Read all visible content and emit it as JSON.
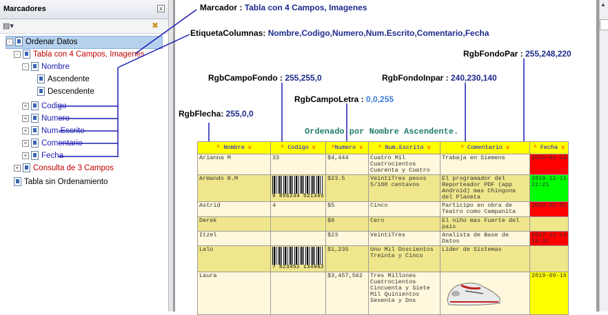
{
  "panel": {
    "title": "Marcadores",
    "close": "x",
    "options_icon": "options-menu-icon",
    "delete_icon": "delete-bookmark-icon"
  },
  "tree": {
    "root": {
      "toggle": "-",
      "label": "Ordenar Datos"
    },
    "item1": {
      "toggle": "-",
      "label": "Tabla con 4 Campos, Imagenes"
    },
    "nombre": {
      "toggle": "-",
      "label": "Nombre"
    },
    "asc": {
      "label": "Ascendente"
    },
    "desc": {
      "label": "Descendente"
    },
    "codigo": {
      "toggle": "+",
      "label": "Codigo"
    },
    "numero": {
      "toggle": "+",
      "label": "Numero"
    },
    "numescrito": {
      "toggle": "+",
      "label": "Num.Escrito"
    },
    "comentario": {
      "toggle": "+",
      "label": "Comentario"
    },
    "fecha": {
      "toggle": "+",
      "label": "Fecha"
    },
    "consulta": {
      "toggle": "+",
      "label": "Consulta de 3 Campos"
    },
    "sin": {
      "label": "Tabla sin Ordenamiento"
    }
  },
  "annotations": {
    "marcador": {
      "key": "Marcador : ",
      "value": "Tabla con 4 Campos, Imagenes"
    },
    "etiqueta": {
      "key": "EtiquetaColumnas: ",
      "value": "Nombre,Codigo,Numero,Num.Escrito,Comentario,Fecha"
    },
    "fondopar": {
      "key": "RgbFondoPar : ",
      "value": "255,248,220"
    },
    "campofondo": {
      "key": "RgbCampoFondo : ",
      "value": "255,255,0"
    },
    "fondoinpar": {
      "key": "RgbFondoInpar : ",
      "value": "240,230,140"
    },
    "campoletra": {
      "key": "RgbCampoLetra : ",
      "value": "0,0,255"
    },
    "flecha": {
      "key": "RgbFlecha: ",
      "value": "255,0,0"
    }
  },
  "ordered_label": "Ordenado por Nombre Ascendente.",
  "table": {
    "headers": [
      {
        "pre": "^",
        "label": "Nombre",
        "post": "v"
      },
      {
        "pre": "^",
        "label": "Codigo",
        "post": "v"
      },
      {
        "pre": "^",
        "label": "Numero",
        "post": "v"
      },
      {
        "pre": "^",
        "label": "Num.Escrito",
        "post": "v"
      },
      {
        "pre": "^",
        "label": "Comentario",
        "post": "v"
      },
      {
        "pre": "^",
        "label": "Fecha",
        "post": "v"
      }
    ],
    "rows": [
      {
        "nombre": "Arianna M",
        "codigo": "33",
        "numero": "$4,444",
        "escrito": "Cuatro Mil Cuatrocientos Cuarenta y Cuatro",
        "comentario": "Trabaja en Siemens",
        "fecha": "2015-01-14"
      },
      {
        "nombre": "Armando R.M",
        "codigo_barcode": "9 856234 521345",
        "numero": "$23.5",
        "escrito": "VeintiTres pesos 5/100 centavos",
        "comentario": "El programador del Reporteador PDF (app Android) mas Chingona del Planeta",
        "fecha": "2019-12-15 21:21"
      },
      {
        "nombre": "Astrid",
        "codigo": "4",
        "numero": "$5",
        "escrito": "Cinco",
        "comentario": "Participo en obra de Teatro como Campanita",
        "fecha": "2014-02-05"
      },
      {
        "nombre": "Derek",
        "codigo": "",
        "numero": "$0",
        "escrito": "Cero",
        "comentario": "El niño mas Fuerte del pais",
        "fecha": ""
      },
      {
        "nombre": "Itzel",
        "codigo": "",
        "numero": "$23",
        "escrito": "VeintiTres",
        "comentario": "Analista de Base de Datos",
        "fecha": "2017-11-14 19:37"
      },
      {
        "nombre": "Lalo",
        "codigo_barcode": "7 823452 134982",
        "numero": "$1,235",
        "escrito": "Uno Mil Doscientos Treinta y Cinco",
        "comentario": "Lider de Sistemas",
        "fecha": ""
      },
      {
        "nombre": "Laura",
        "codigo": "",
        "numero": "$3,457,562",
        "escrito": "Tres Millones Cuatrocientos Cincuenta y Siete Mil Quinientos Sesenta y Dos",
        "comentario": "",
        "comentario_image": "sneaker-image",
        "fecha": "2019-09-16"
      }
    ]
  },
  "colors": {
    "campo_fondo": "#ffff00",
    "campo_letra": "#0000ff",
    "fondo_par": "#fff8dc",
    "fondo_inpar": "#f0e68c",
    "flecha": "#ff0000",
    "annotation_value": "#1c2a8c",
    "line": "#1a1ab0"
  }
}
